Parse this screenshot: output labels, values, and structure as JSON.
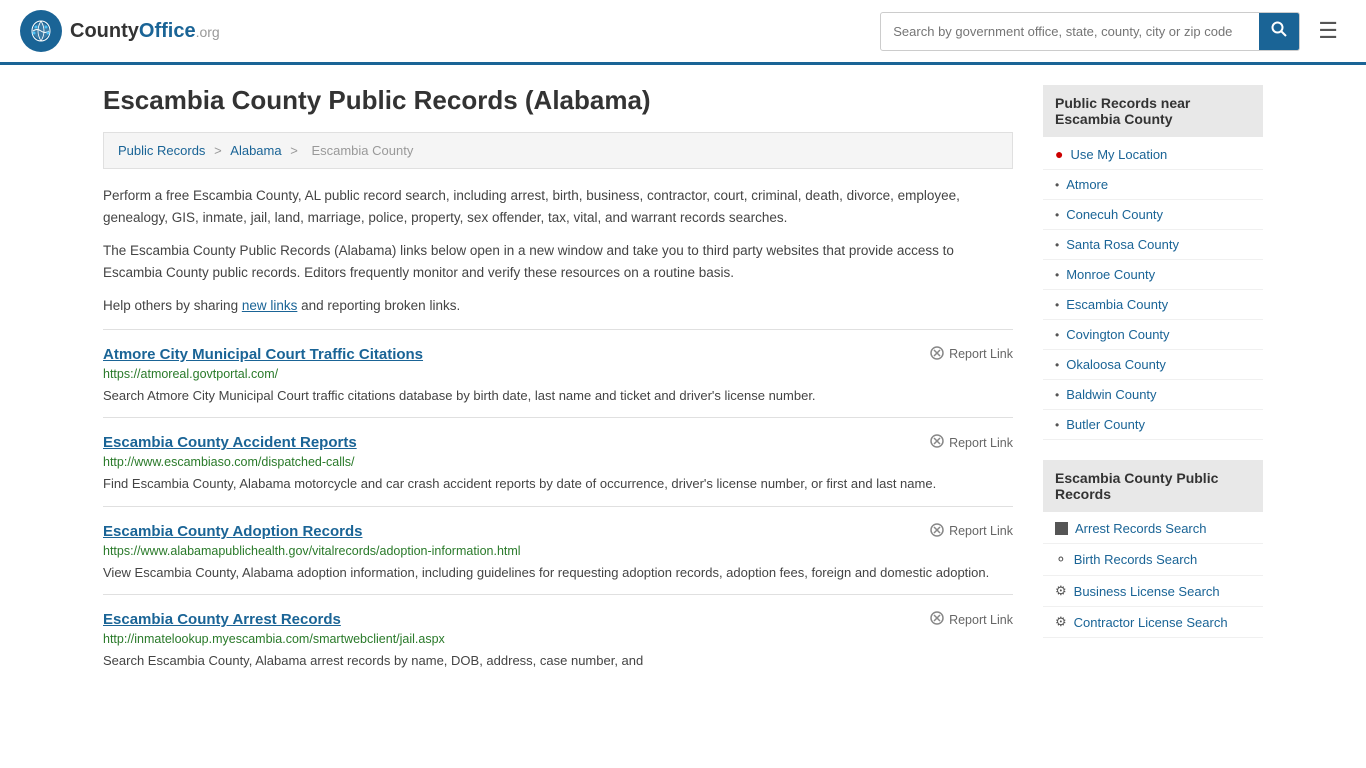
{
  "header": {
    "logo_text": "CountyOffice",
    "logo_org": ".org",
    "search_placeholder": "Search by government office, state, county, city or zip code",
    "search_value": ""
  },
  "page": {
    "title": "Escambia County Public Records (Alabama)",
    "breadcrumb": {
      "items": [
        "Public Records",
        "Alabama",
        "Escambia County"
      ]
    },
    "description1": "Perform a free Escambia County, AL public record search, including arrest, birth, business, contractor, court, criminal, death, divorce, employee, genealogy, GIS, inmate, jail, land, marriage, police, property, sex offender, tax, vital, and warrant records searches.",
    "description2": "The Escambia County Public Records (Alabama) links below open in a new window and take you to third party websites that provide access to Escambia County public records. Editors frequently monitor and verify these resources on a routine basis.",
    "description3_pre": "Help others by sharing ",
    "description3_link": "new links",
    "description3_post": " and reporting broken links.",
    "records": [
      {
        "title": "Atmore City Municipal Court Traffic Citations",
        "url": "https://atmoreal.govtportal.com/",
        "desc": "Search Atmore City Municipal Court traffic citations database by birth date, last name and ticket and driver's license number."
      },
      {
        "title": "Escambia County Accident Reports",
        "url": "http://www.escambiaso.com/dispatched-calls/",
        "desc": "Find Escambia County, Alabama motorcycle and car crash accident reports by date of occurrence, driver's license number, or first and last name."
      },
      {
        "title": "Escambia County Adoption Records",
        "url": "https://www.alabamapublichealth.gov/vitalrecords/adoption-information.html",
        "desc": "View Escambia County, Alabama adoption information, including guidelines for requesting adoption records, adoption fees, foreign and domestic adoption."
      },
      {
        "title": "Escambia County Arrest Records",
        "url": "http://inmatelookup.myescambia.com/smartwebclient/jail.aspx",
        "desc": "Search Escambia County, Alabama arrest records by name, DOB, address, case number, and"
      }
    ],
    "report_link_label": "Report Link"
  },
  "sidebar": {
    "nearby_header": "Public Records near Escambia County",
    "nearby_items": [
      {
        "label": "Use My Location",
        "icon": "location"
      },
      {
        "label": "Atmore",
        "icon": "link"
      },
      {
        "label": "Conecuh County",
        "icon": "link"
      },
      {
        "label": "Santa Rosa County",
        "icon": "link"
      },
      {
        "label": "Monroe County",
        "icon": "link"
      },
      {
        "label": "Escambia County",
        "icon": "link"
      },
      {
        "label": "Covington County",
        "icon": "link"
      },
      {
        "label": "Okaloosa County",
        "icon": "link"
      },
      {
        "label": "Baldwin County",
        "icon": "link"
      },
      {
        "label": "Butler County",
        "icon": "link"
      }
    ],
    "public_records_header": "Escambia County Public Records",
    "public_records_items": [
      {
        "label": "Arrest Records Search",
        "icon": "square"
      },
      {
        "label": "Birth Records Search",
        "icon": "person"
      },
      {
        "label": "Business License Search",
        "icon": "gear"
      },
      {
        "label": "Contractor License Search",
        "icon": "gear"
      }
    ]
  }
}
